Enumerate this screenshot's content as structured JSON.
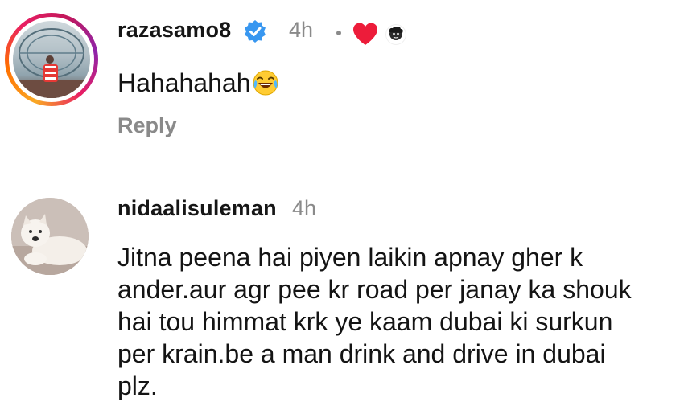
{
  "comments": [
    {
      "username": "razasamo8",
      "time": "4h",
      "verified": true,
      "liked_by_author": true,
      "text": "Hahahahah",
      "emoji": "face-with-tears-of-joy",
      "reply_label": "Reply"
    },
    {
      "username": "nidaalisuleman",
      "time": "4h",
      "text_lines": [
        "Jitna peena hai piyen laikin apnay gher k",
        "ander.aur agr pee kr road per janay ka shouk",
        "hai tou himmat krk ye kaam dubai ki surkun",
        "per krain.be a man drink and drive in dubai",
        "plz."
      ]
    }
  ],
  "colors": {
    "text": "#141414",
    "muted": "#8a8a8a",
    "verified_blue": "#3897f0",
    "heart_red": "#ed1c3a"
  }
}
